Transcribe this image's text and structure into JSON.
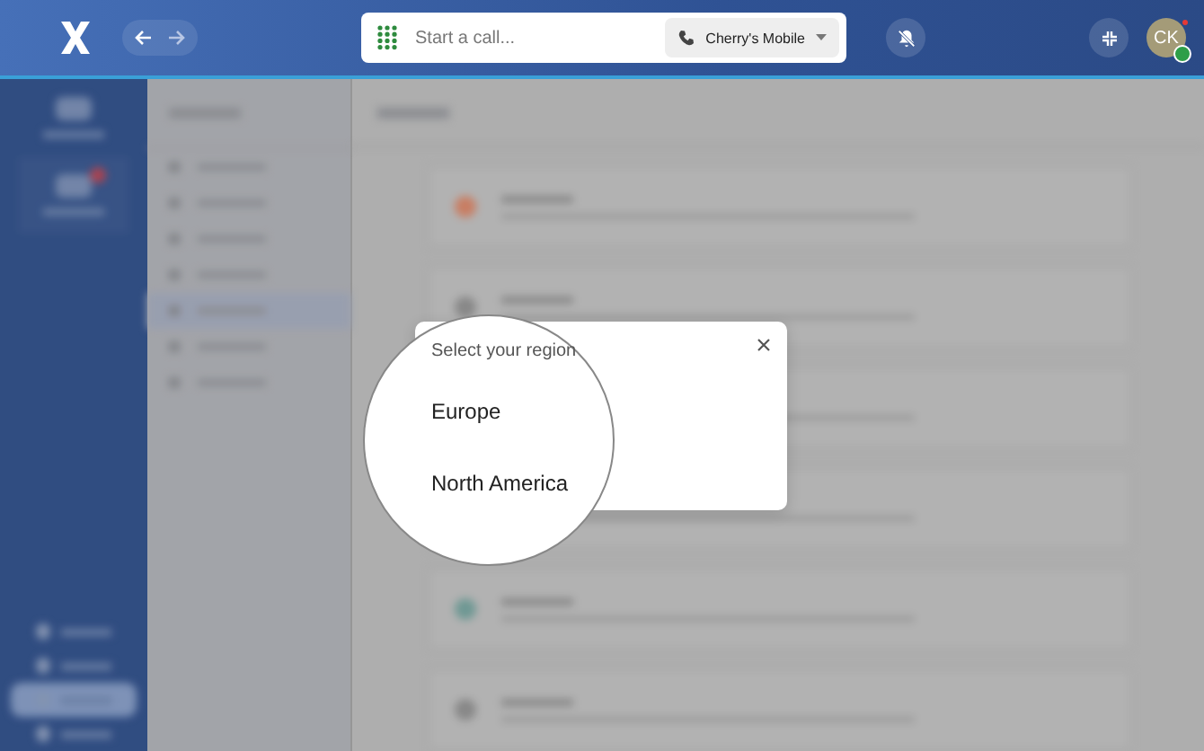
{
  "search": {
    "placeholder": "Start a call..."
  },
  "device": {
    "label": "Cherry's Mobile"
  },
  "avatar": {
    "initials": "CK",
    "online": true
  },
  "dialog": {
    "title": "Select your region",
    "regions": [
      {
        "label": "Europe"
      },
      {
        "label": "North America"
      }
    ]
  }
}
